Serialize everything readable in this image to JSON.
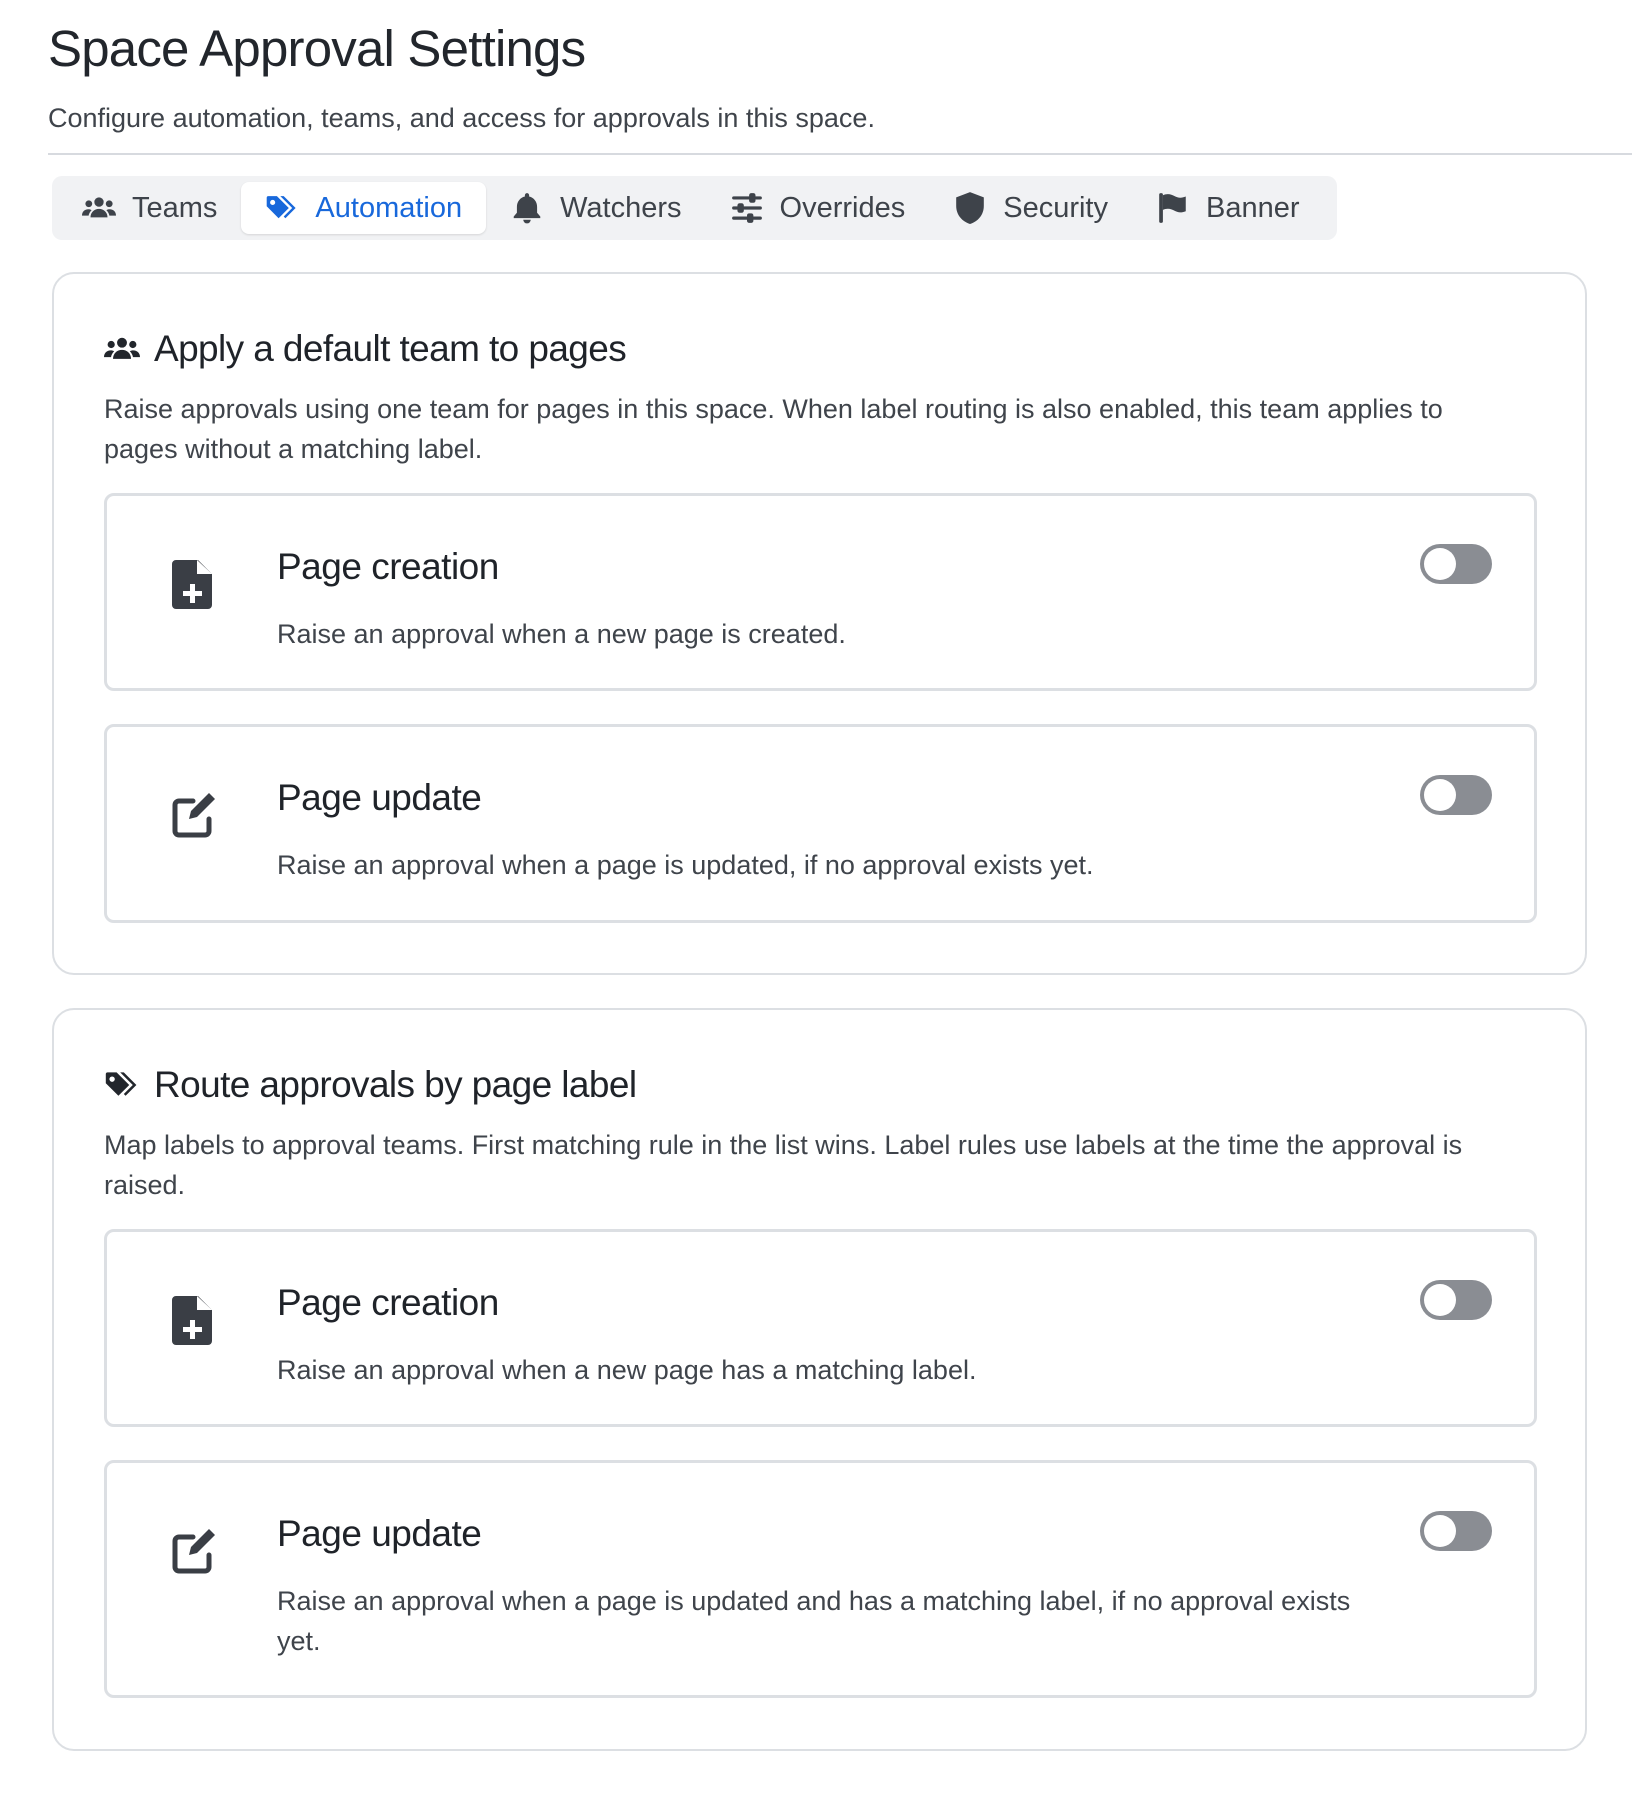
{
  "header": {
    "title": "Space Approval Settings",
    "subtitle": "Configure automation, teams, and access for approvals in this space."
  },
  "tabs": [
    {
      "label": "Teams",
      "icon": "users-icon",
      "active": false
    },
    {
      "label": "Automation",
      "icon": "tags-icon",
      "active": true
    },
    {
      "label": "Watchers",
      "icon": "bell-icon",
      "active": false
    },
    {
      "label": "Overrides",
      "icon": "sliders-icon",
      "active": false
    },
    {
      "label": "Security",
      "icon": "shield-icon",
      "active": false
    },
    {
      "label": "Banner",
      "icon": "flag-icon",
      "active": false
    }
  ],
  "colors": {
    "accent": "#1868db",
    "text": "#1f2329",
    "muted_text": "#3f444b",
    "border": "#dcdfe3",
    "tabbar_bg": "#f1f2f4",
    "toggle_off": "#8a8d93"
  },
  "sections": [
    {
      "icon": "users-icon",
      "title": "Apply a default team to pages",
      "description": "Raise approvals using one team for pages in this space. When label routing is also enabled, this team applies to pages without a matching label.",
      "cards": [
        {
          "icon": "file-plus-icon",
          "title": "Page creation",
          "description": "Raise an approval when a new page is created.",
          "enabled": false
        },
        {
          "icon": "edit-icon",
          "title": "Page update",
          "description": "Raise an approval when a page is updated, if no approval exists yet.",
          "enabled": false
        }
      ]
    },
    {
      "icon": "tags-icon",
      "title": "Route approvals by page label",
      "description": "Map labels to approval teams. First matching rule in the list wins. Label rules use labels at the time the approval is raised.",
      "cards": [
        {
          "icon": "file-plus-icon",
          "title": "Page creation",
          "description": "Raise an approval when a new page has a matching label.",
          "enabled": false
        },
        {
          "icon": "edit-icon",
          "title": "Page update",
          "description": "Raise an approval when a page is updated and has a matching label, if no approval exists yet.",
          "enabled": false
        }
      ]
    }
  ]
}
